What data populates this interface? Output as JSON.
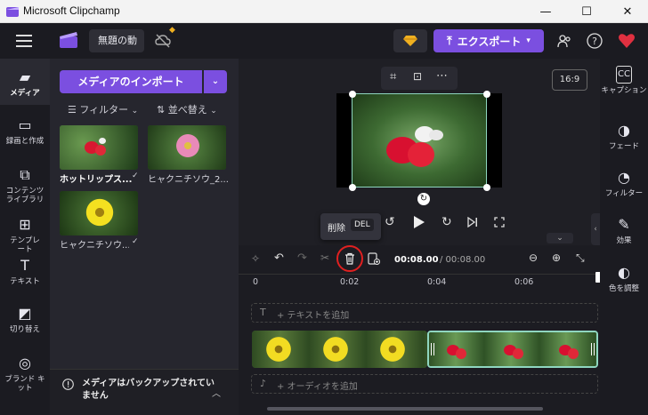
{
  "window": {
    "title": "Microsoft Clipchamp",
    "minimize": "—",
    "maximize": "☐",
    "close": "✕"
  },
  "appbar": {
    "project_name": "無題の動",
    "export_label": "エクスポート"
  },
  "leftnav": [
    {
      "label": "メディア",
      "icon": "folder-icon"
    },
    {
      "label": "録画と作成",
      "icon": "camera-icon"
    },
    {
      "label": "コンテンツ\nライブラリ",
      "icon": "library-icon"
    },
    {
      "label": "テンプレ\nート",
      "icon": "templates-icon"
    },
    {
      "label": "テキスト",
      "icon": "text-icon"
    },
    {
      "label": "切り替え",
      "icon": "transitions-icon"
    },
    {
      "label": "ブランド キ\nット",
      "icon": "brand-kit-icon"
    }
  ],
  "media": {
    "import_label": "メディアのインポート",
    "filter_label": "フィルター",
    "sort_label": "並べ替え",
    "items": [
      {
        "name": "ホットリップス..."
      },
      {
        "name": "ヒャクニチソウ_2..."
      },
      {
        "name": "ヒャクニチソウ..."
      }
    ],
    "backup_notice": "メディアはバックアップされていません"
  },
  "preview": {
    "aspect_ratio": "16:9"
  },
  "tooltip": {
    "label": "削除",
    "shortcut": "DEL"
  },
  "timeline": {
    "current_time": "00:08.00",
    "total_time": "/ 00:08.00",
    "ruler": [
      "0",
      "0:02",
      "0:04",
      "0:06"
    ],
    "text_track": "+ テキストを追加",
    "audio_track": "+ オーディオを追加"
  },
  "rightnav": [
    {
      "label": "キャプション",
      "icon": "captions-icon"
    },
    {
      "label": "フェード",
      "icon": "fade-icon"
    },
    {
      "label": "フィルター",
      "icon": "filter-icon"
    },
    {
      "label": "効果",
      "icon": "effects-icon"
    },
    {
      "label": "色を調整",
      "icon": "color-adjust-icon"
    }
  ],
  "colors": {
    "accent": "#7b4fe0",
    "selection": "#8fd6c0",
    "highlight_ring": "#e02020"
  }
}
